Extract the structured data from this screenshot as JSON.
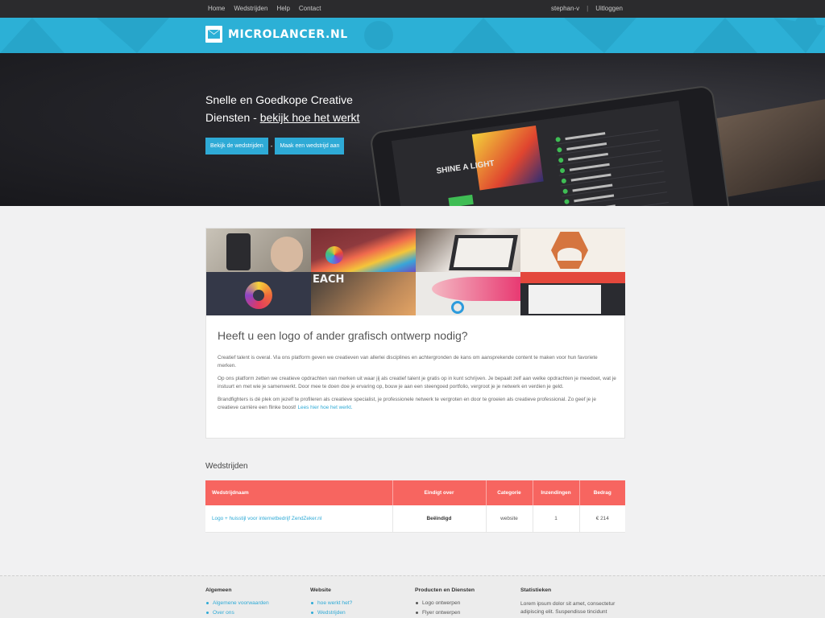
{
  "topnav": {
    "links": [
      "Home",
      "Wedstrijden",
      "Help",
      "Contact"
    ],
    "user": "stephan-v",
    "separator": "|",
    "logout": "Uitloggen"
  },
  "brand": {
    "name": "MICROLANCER.NL",
    "color": "#2cb0d6"
  },
  "hero": {
    "title_line1": "Snelle en Goedkope Creative",
    "title_line2_prefix": "Diensten - ",
    "title_link": "bekijk hoe het werkt",
    "btn_view": "Bekijk de wedstrijden",
    "btn_sep": "-",
    "btn_create": "Maak een wedstrijd aan",
    "album_title": "SHINE A LIGHT"
  },
  "card": {
    "title": "Heeft u een logo of ander grafisch ontwerp nodig?",
    "p1": "Creatief talent is overal. Via ons platform geven we creatieven van allerlei disciplines en achtergronden de kans om aansprekende content te maken voor hun favoriete merken.",
    "p2": "Op ons platform zetten we creatieve opdrachten van merken uit waar jij als creatief talent je gratis op in kunt schrijven. Je bepaalt zelf aan welke opdrachten je meedoet, wat je instuurt en met wie je samenwerkt. Door mee te doen doe je ervaring op, bouw je aan een steengoed portfolio, vergroot je je netwerk en verdien je geld.",
    "p3": "Brandfighters is dé plek om jezelf te profileren als creatieve specialist, je professionele netwerk te vergroten en door te groeien als creatieve professional. Zo geef je je creatieve carrière een flinke boost!",
    "p3_link": "Lees hier hoe het werkt."
  },
  "competitions": {
    "title": "Wedstrijden",
    "headers": [
      "Wedstrijdnaam",
      "Eindigt over",
      "Categorie",
      "Inzendingen",
      "Bedrag"
    ],
    "rows": [
      {
        "name": "Logo + huisstijl voor internetbedrijf ZendZeker.nl",
        "ends": "Beëindigd",
        "category": "website",
        "entries": "1",
        "amount": "€ 214"
      }
    ],
    "header_color": "#f76560"
  },
  "footer": {
    "col1": {
      "title": "Algemeen",
      "items": [
        "Algemene voorwaarden",
        "Over ons"
      ]
    },
    "col2": {
      "title": "Website",
      "items": [
        "hoe werkt het?",
        "Wedstrijden"
      ]
    },
    "col3": {
      "title": "Producten en Diensten",
      "items": [
        "Logo ontwerpen",
        "Flyer ontwerpen"
      ]
    },
    "col4": {
      "title": "Statistieken",
      "text": "Lorem ipsum dolor sit amet, consectetur adipiscing elit. Suspendisse tincidunt"
    }
  }
}
